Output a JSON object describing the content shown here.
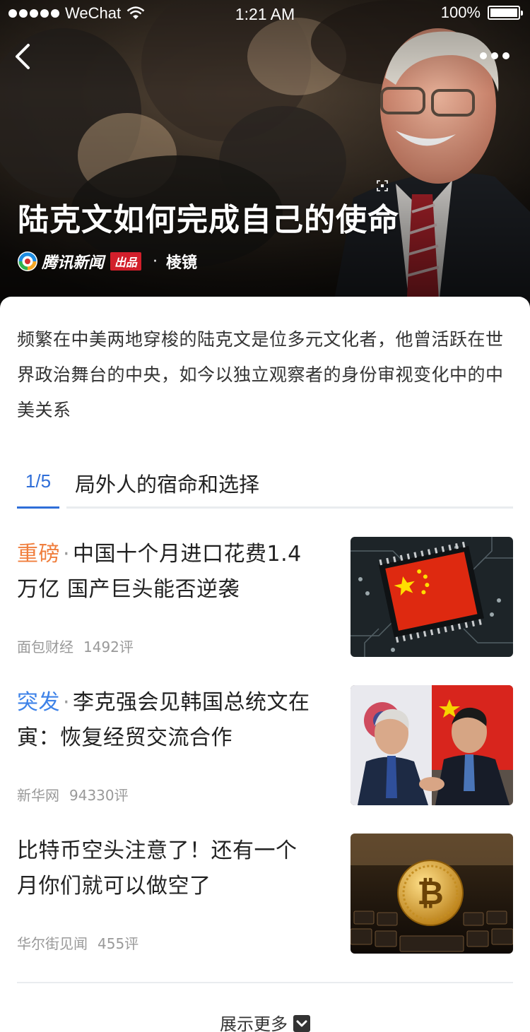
{
  "status_bar": {
    "carrier": "WeChat",
    "time": "1:21 AM",
    "battery": "100%"
  },
  "icons": {
    "back": "chevron-left-icon",
    "more": "more-dots-icon",
    "wifi": "wifi-icon",
    "battery": "battery-icon",
    "scan": "scan-icon",
    "expand": "chevron-down-icon"
  },
  "hero": {
    "title": "陆克文如何完成自己的使命",
    "brand": "腾讯新闻",
    "brand_tag": "出品",
    "separator": "·",
    "column": "棱镜"
  },
  "summary": "频繁在中美两地穿梭的陆克文是位多元文化者，他曾活跃在世界政治舞台的中央，如今以独立观察者的身份审视变化中的中美关系",
  "chapter": {
    "number": "1/5",
    "title": "局外人的宿命和选择"
  },
  "news": [
    {
      "tag": "重磅",
      "tag_color": "#f07e3d",
      "separator": "·",
      "title": "中国十个月进口花费1.4万亿 国产巨头能否逆袭",
      "source": "面包财经",
      "comments": "1492评"
    },
    {
      "tag": "突发",
      "tag_color": "#3d82e8",
      "separator": "·",
      "title": "李克强会见韩国总统文在寅：恢复经贸交流合作",
      "source": "新华网",
      "comments": "94330评"
    },
    {
      "tag": "",
      "tag_color": "",
      "separator": "",
      "title": "比特币空头注意了！还有一个月你们就可以做空了",
      "source": "华尔街见闻",
      "comments": "455评"
    }
  ],
  "footer": {
    "show_more": "展示更多"
  }
}
